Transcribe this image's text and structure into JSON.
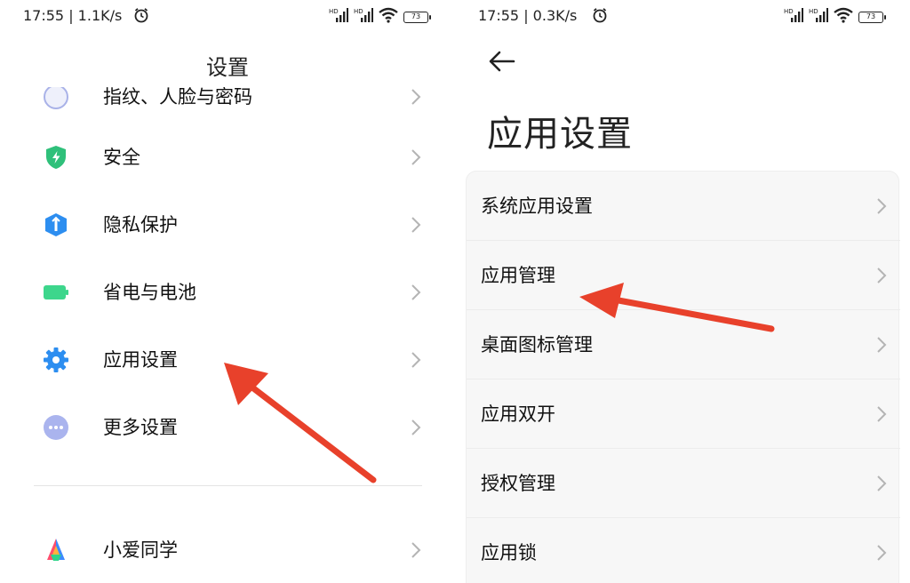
{
  "colors": {
    "accent_arrow": "#e8412b",
    "shield_green": "#2fc07a",
    "privacy_blue": "#2d8ef0",
    "battery_green": "#3dd68c",
    "gear_blue": "#2d8ef0",
    "more_lavender": "#aab4ee"
  },
  "left": {
    "status": {
      "time_speed": "17:55 | 1.1K/s",
      "battery": "73"
    },
    "title": "设置",
    "items": [
      {
        "label": "指纹、人脸与密码",
        "icon": "fingerprint-icon"
      },
      {
        "label": "安全",
        "icon": "security-shield-icon"
      },
      {
        "label": "隐私保护",
        "icon": "privacy-icon"
      },
      {
        "label": "省电与电池",
        "icon": "battery-icon"
      },
      {
        "label": "应用设置",
        "icon": "gear-icon"
      },
      {
        "label": "更多设置",
        "icon": "more-icon"
      },
      {
        "label": "小爱同学",
        "icon": "xiaoai-icon"
      }
    ]
  },
  "right": {
    "status": {
      "time_speed": "17:55 | 0.3K/s",
      "battery": "73"
    },
    "title": "应用设置",
    "items": [
      {
        "label": "系统应用设置"
      },
      {
        "label": "应用管理"
      },
      {
        "label": "桌面图标管理"
      },
      {
        "label": "应用双开"
      },
      {
        "label": "授权管理"
      },
      {
        "label": "应用锁"
      }
    ]
  }
}
